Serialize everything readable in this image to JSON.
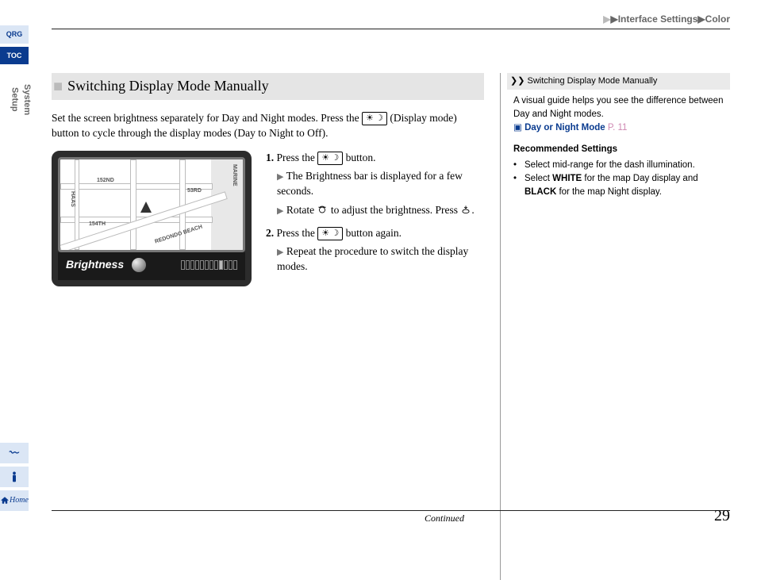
{
  "breadcrumb": {
    "s1": "Interface Settings",
    "s2": "Color"
  },
  "rail": {
    "qrg": "QRG",
    "toc": "TOC",
    "section": "System Setup",
    "home": "Home"
  },
  "heading": "Switching Display Mode Manually",
  "intro1": "Set the screen brightness separately for Day and Night modes. Press the ",
  "intro2": " (Display mode) button to cycle through the display modes (Day to Night to Off).",
  "keycap_glyph": "☀ ☽",
  "device": {
    "brightness_label": "Brightness",
    "streets": {
      "s1": "152ND",
      "s2": "53RD",
      "s3": "154TH",
      "s4": "REDONDO BEACH",
      "s5": "MARINE",
      "s6": "HAAS"
    }
  },
  "steps": {
    "s1a": "Press the ",
    "s1b": " button.",
    "s1sub1a": "The Brightness bar is displayed for a few seconds.",
    "s1sub2a": "Rotate ",
    "s1sub2b": " to adjust the brightness. Press ",
    "s1sub2c": ".",
    "s2a": "Press the ",
    "s2b": " button again.",
    "s2sub1": "Repeat the procedure to switch the display modes."
  },
  "sidebar": {
    "title": "Switching Display Mode Manually",
    "body": "A visual guide helps you see the difference between Day and Night modes.",
    "link": "Day or Night Mode",
    "link_page": "P. 11",
    "rec_heading": "Recommended Settings",
    "rec1": "Select mid-range for the dash illumination.",
    "rec2a": "Select ",
    "rec2b": "WHITE",
    "rec2c": " for the map Day display and ",
    "rec2d": "BLACK",
    "rec2e": " for the map Night display."
  },
  "footer": {
    "continued": "Continued",
    "page": "29"
  }
}
